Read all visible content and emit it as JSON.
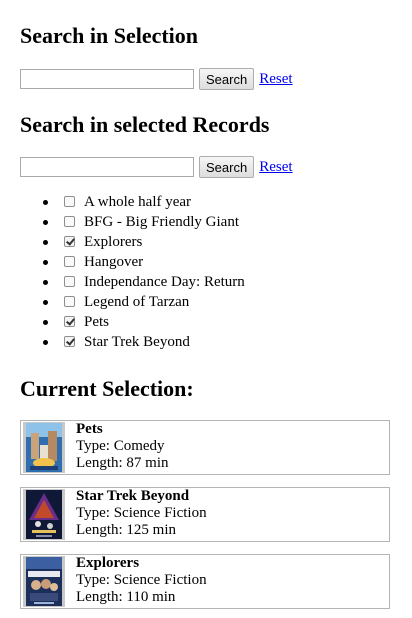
{
  "search_selection": {
    "heading": "Search in Selection",
    "input_value": "",
    "button_label": "Search",
    "reset_label": "Reset"
  },
  "search_records": {
    "heading": "Search in selected Records",
    "input_value": "",
    "button_label": "Search",
    "reset_label": "Reset"
  },
  "records": [
    {
      "label": "A whole half year",
      "checked": false
    },
    {
      "label": "BFG - Big Friendly Giant",
      "checked": false
    },
    {
      "label": "Explorers",
      "checked": true
    },
    {
      "label": "Hangover",
      "checked": false
    },
    {
      "label": "Independance Day: Return",
      "checked": false
    },
    {
      "label": "Legend of Tarzan",
      "checked": false
    },
    {
      "label": "Pets",
      "checked": true
    },
    {
      "label": "Star Trek Beyond",
      "checked": true
    }
  ],
  "current_selection": {
    "heading": "Current Selection:",
    "items": [
      {
        "title": "Pets",
        "type": "Type: Comedy",
        "length": "Length: 87 min"
      },
      {
        "title": "Star Trek Beyond",
        "type": "Type: Science Fiction",
        "length": "Length: 125 min"
      },
      {
        "title": "Explorers",
        "type": "Type: Science Fiction",
        "length": "Length: 110 min"
      }
    ]
  }
}
